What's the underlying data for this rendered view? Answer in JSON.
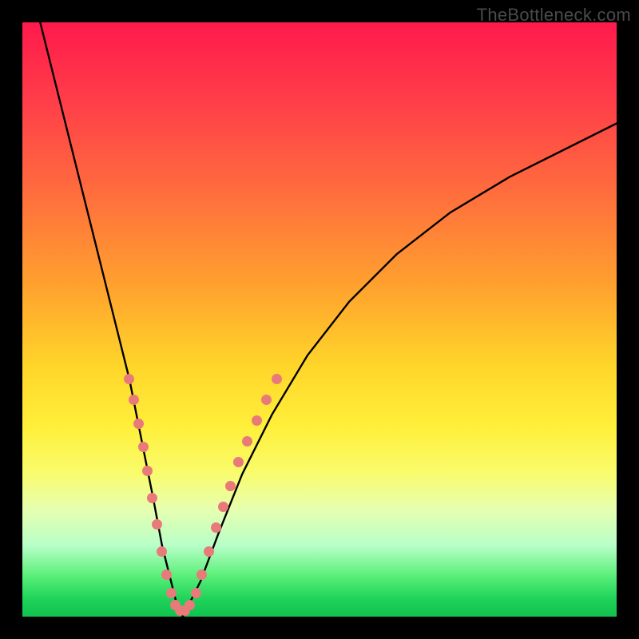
{
  "watermark": "TheBottleneck.com",
  "chart_data": {
    "type": "line",
    "title": "",
    "xlabel": "",
    "ylabel": "",
    "xlim": [
      0,
      100
    ],
    "ylim": [
      0,
      100
    ],
    "series": [
      {
        "name": "bottleneck-curve",
        "x": [
          3,
          6,
          9,
          12,
          15,
          18,
          20,
          22,
          23.5,
          25,
          26,
          27,
          28,
          30,
          33,
          37,
          42,
          48,
          55,
          63,
          72,
          82,
          92,
          100
        ],
        "y": [
          100,
          88,
          76,
          64,
          52,
          40,
          30,
          20,
          12,
          6,
          2,
          0,
          2,
          6,
          14,
          24,
          34,
          44,
          53,
          61,
          68,
          74,
          79,
          83
        ]
      }
    ],
    "markers": {
      "name": "highlight-dots",
      "points": [
        {
          "x": 18.0,
          "y": 40.0
        },
        {
          "x": 18.8,
          "y": 36.5
        },
        {
          "x": 19.6,
          "y": 32.5
        },
        {
          "x": 20.3,
          "y": 28.5
        },
        {
          "x": 21.0,
          "y": 24.5
        },
        {
          "x": 21.8,
          "y": 20.0
        },
        {
          "x": 22.6,
          "y": 15.5
        },
        {
          "x": 23.4,
          "y": 11.0
        },
        {
          "x": 24.2,
          "y": 7.0
        },
        {
          "x": 25.0,
          "y": 4.0
        },
        {
          "x": 25.8,
          "y": 2.0
        },
        {
          "x": 26.6,
          "y": 1.0
        },
        {
          "x": 27.4,
          "y": 1.0
        },
        {
          "x": 28.2,
          "y": 2.0
        },
        {
          "x": 29.2,
          "y": 4.0
        },
        {
          "x": 30.2,
          "y": 7.0
        },
        {
          "x": 31.4,
          "y": 11.0
        },
        {
          "x": 32.6,
          "y": 15.0
        },
        {
          "x": 33.8,
          "y": 18.5
        },
        {
          "x": 35.0,
          "y": 22.0
        },
        {
          "x": 36.4,
          "y": 26.0
        },
        {
          "x": 37.8,
          "y": 29.5
        },
        {
          "x": 39.4,
          "y": 33.0
        },
        {
          "x": 41.0,
          "y": 36.5
        },
        {
          "x": 42.8,
          "y": 40.0
        }
      ]
    }
  }
}
